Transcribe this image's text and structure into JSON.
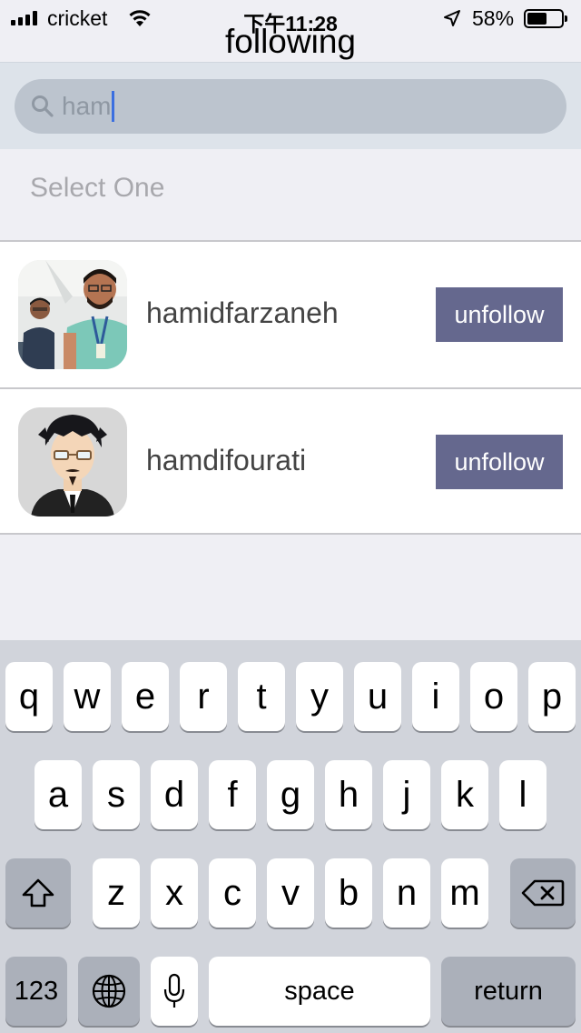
{
  "status": {
    "carrier": "cricket",
    "time": "下午11:28",
    "battery": "58%",
    "battery_level": 0.58
  },
  "nav": {
    "title": "following"
  },
  "search": {
    "value": "ham"
  },
  "hint": "Select One",
  "users": [
    {
      "username": "hamidfarzaneh",
      "action": "unfollow"
    },
    {
      "username": "hamdifourati",
      "action": "unfollow"
    }
  ],
  "keyboard": {
    "row1": [
      "q",
      "w",
      "e",
      "r",
      "t",
      "y",
      "u",
      "i",
      "o",
      "p"
    ],
    "row2": [
      "a",
      "s",
      "d",
      "f",
      "g",
      "h",
      "j",
      "k",
      "l"
    ],
    "row3": [
      "z",
      "x",
      "c",
      "v",
      "b",
      "n",
      "m"
    ],
    "numbers": "123",
    "space": "space",
    "return": "return"
  },
  "icons": {
    "signal": "signal-icon",
    "wifi": "wifi-icon",
    "location": "location-icon",
    "battery": "battery-icon",
    "search": "search-icon",
    "shift": "shift-icon",
    "delete": "delete-icon",
    "globe": "globe-icon",
    "mic": "microphone-icon"
  },
  "colors": {
    "button": "#65688e",
    "caret": "#3b6fe0"
  }
}
